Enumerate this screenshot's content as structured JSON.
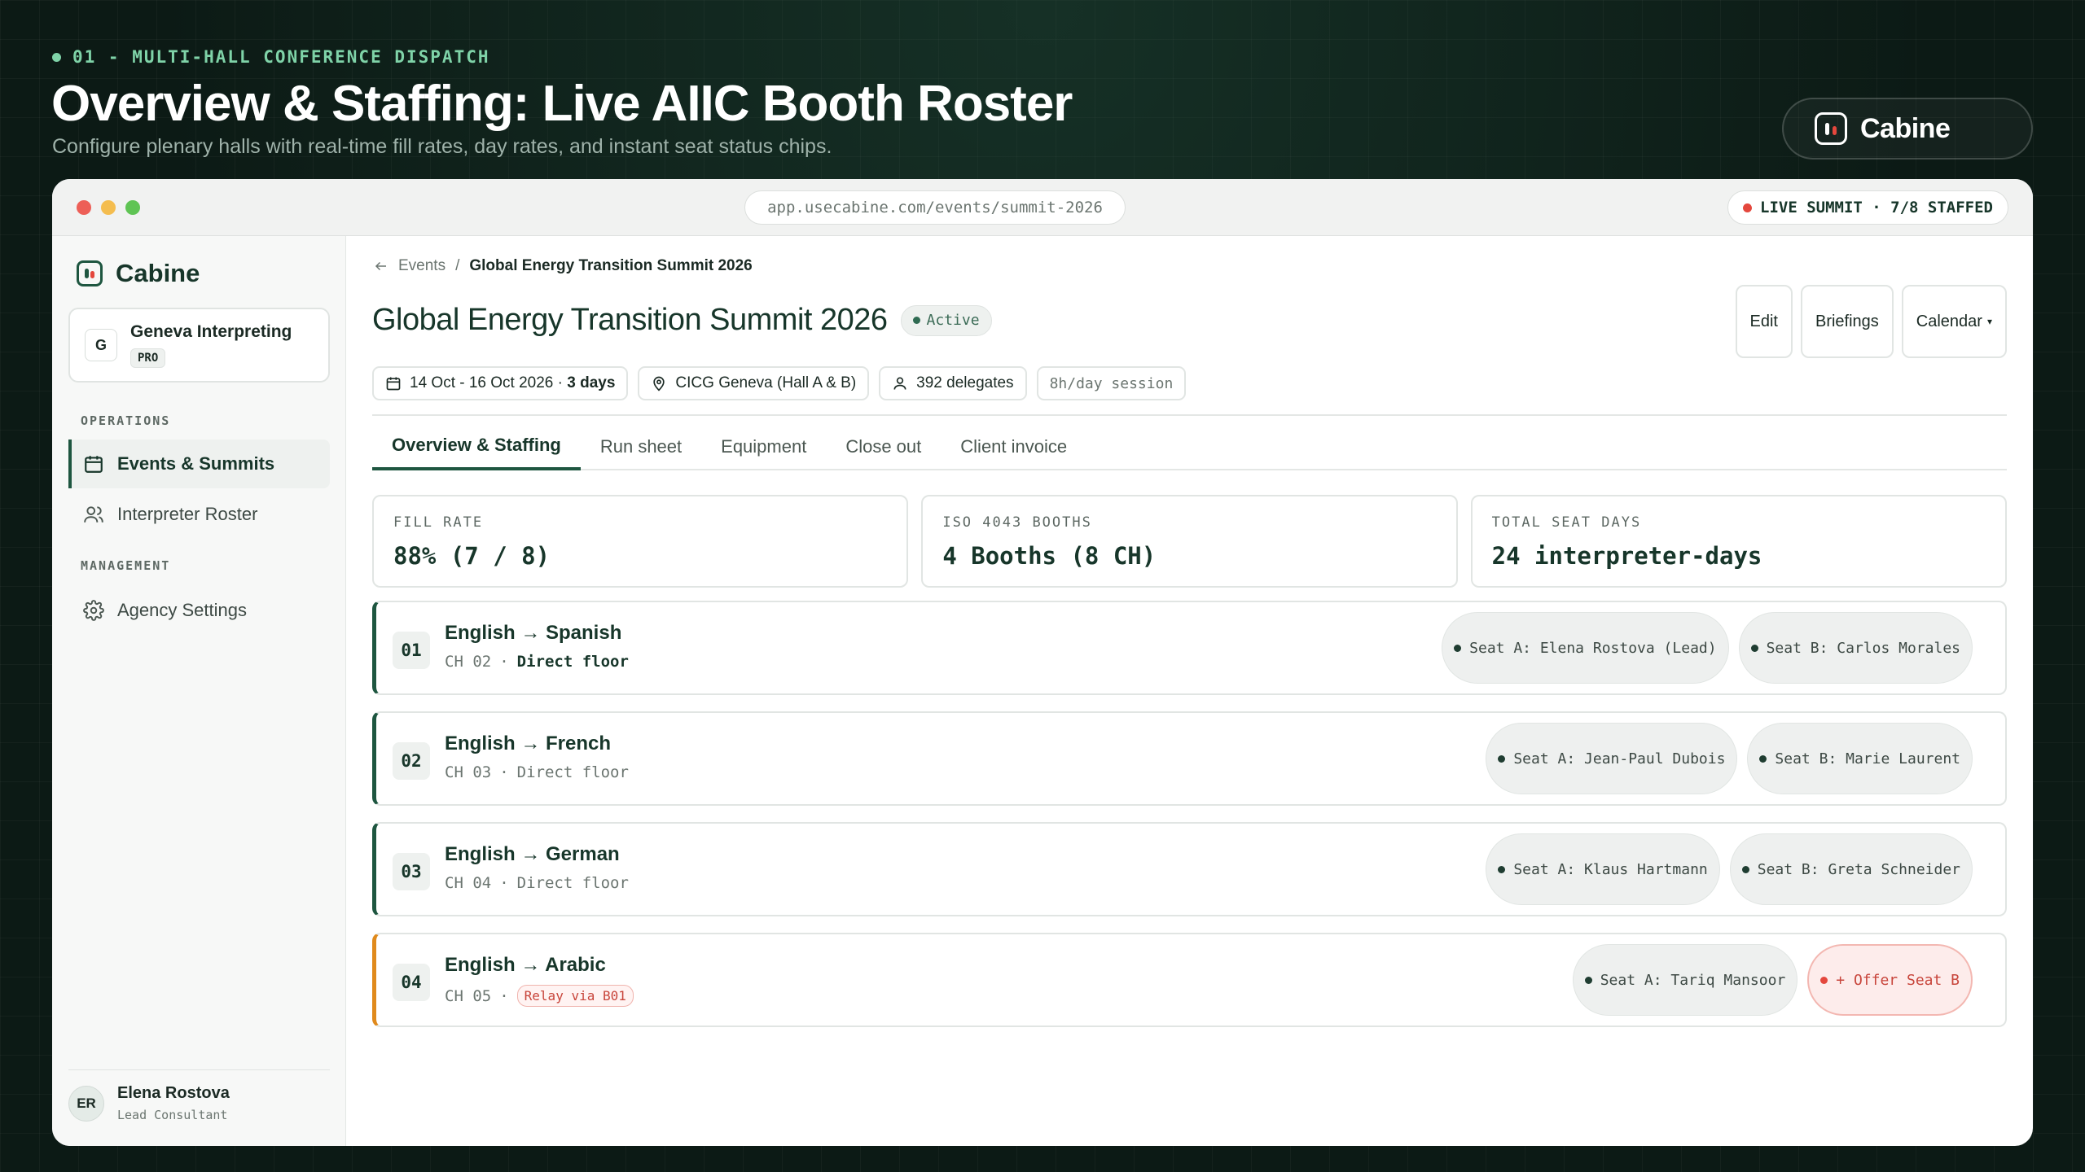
{
  "eyebrow": "01 - MULTI-HALL CONFERENCE DISPATCH",
  "hero": {
    "title": "Overview & Staffing: Live AIIC Booth Roster",
    "subtitle": "Configure plenary halls with real-time fill rates, day rates, and instant seat status chips."
  },
  "brand": {
    "name": "Cabine"
  },
  "window": {
    "url": "app.usecabine.com/events/summit-2026",
    "live_status": "LIVE SUMMIT · 7/8 STAFFED"
  },
  "sidebar": {
    "brand": "Cabine",
    "org": {
      "initial": "G",
      "name": "Geneva Interpreting",
      "badge": "PRO"
    },
    "sections": [
      {
        "title": "OPERATIONS",
        "items": [
          {
            "label": "Events & Summits"
          },
          {
            "label": "Interpreter Roster"
          }
        ]
      },
      {
        "title": "MANAGEMENT",
        "items": [
          {
            "label": "Agency Settings"
          }
        ]
      }
    ],
    "user": {
      "initials": "ER",
      "name": "Elena Rostova",
      "role": "Lead Consultant"
    }
  },
  "main": {
    "breadcrumb": {
      "parent": "Events",
      "separator": "/",
      "current": "Global Energy Transition Summit 2026"
    },
    "title": "Global Energy Transition Summit 2026",
    "status": "Active",
    "actions": {
      "edit": "Edit",
      "briefings": "Briefings",
      "calendar": "Calendar",
      "calendar_caret": "▾"
    },
    "meta": {
      "dates": "14 Oct - 16 Oct 2026 · ",
      "duration": "3 days",
      "venue": "CICG Geneva (Hall A & B)",
      "delegates": "392 delegates",
      "session": "8h/day session"
    },
    "tabs": [
      "Overview & Staffing",
      "Run sheet",
      "Equipment",
      "Close out",
      "Client invoice"
    ],
    "kpis": [
      {
        "label": "FILL RATE",
        "value": "88% (7 / 8)"
      },
      {
        "label": "ISO 4043 BOOTHS",
        "value": "4 Booths (8 CH)"
      },
      {
        "label": "TOTAL SEAT DAYS",
        "value": "24 interpreter-days"
      }
    ],
    "booths": [
      {
        "num": "01",
        "lang": "English → Spanish",
        "channel": "CH 02",
        "sep": "·",
        "floor": "Direct floor",
        "seats": [
          "Seat A: Elena Rostova (Lead)",
          "Seat B: Carlos Morales"
        ]
      },
      {
        "num": "02",
        "lang": "English → French",
        "channel": "CH 03",
        "sep": "·",
        "floor": "Direct floor",
        "seats": [
          "Seat A: Jean-Paul Dubois",
          "Seat B: Marie Laurent"
        ]
      },
      {
        "num": "03",
        "lang": "English → German",
        "channel": "CH 04",
        "sep": "·",
        "floor": "Direct floor",
        "seats": [
          "Seat A: Klaus Hartmann",
          "Seat B: Greta Schneider"
        ]
      },
      {
        "num": "04",
        "lang": "English → Arabic",
        "channel": "CH 05",
        "sep": "·",
        "floor": "Relay via B01",
        "seats": [
          "Seat A: Tariq Mansoor",
          "+ Offer Seat B"
        ]
      }
    ]
  },
  "colors": {
    "accent": "#1e5640",
    "alert": "#e4473d",
    "warning": "#e08a1c",
    "background": "#0c1a15"
  }
}
